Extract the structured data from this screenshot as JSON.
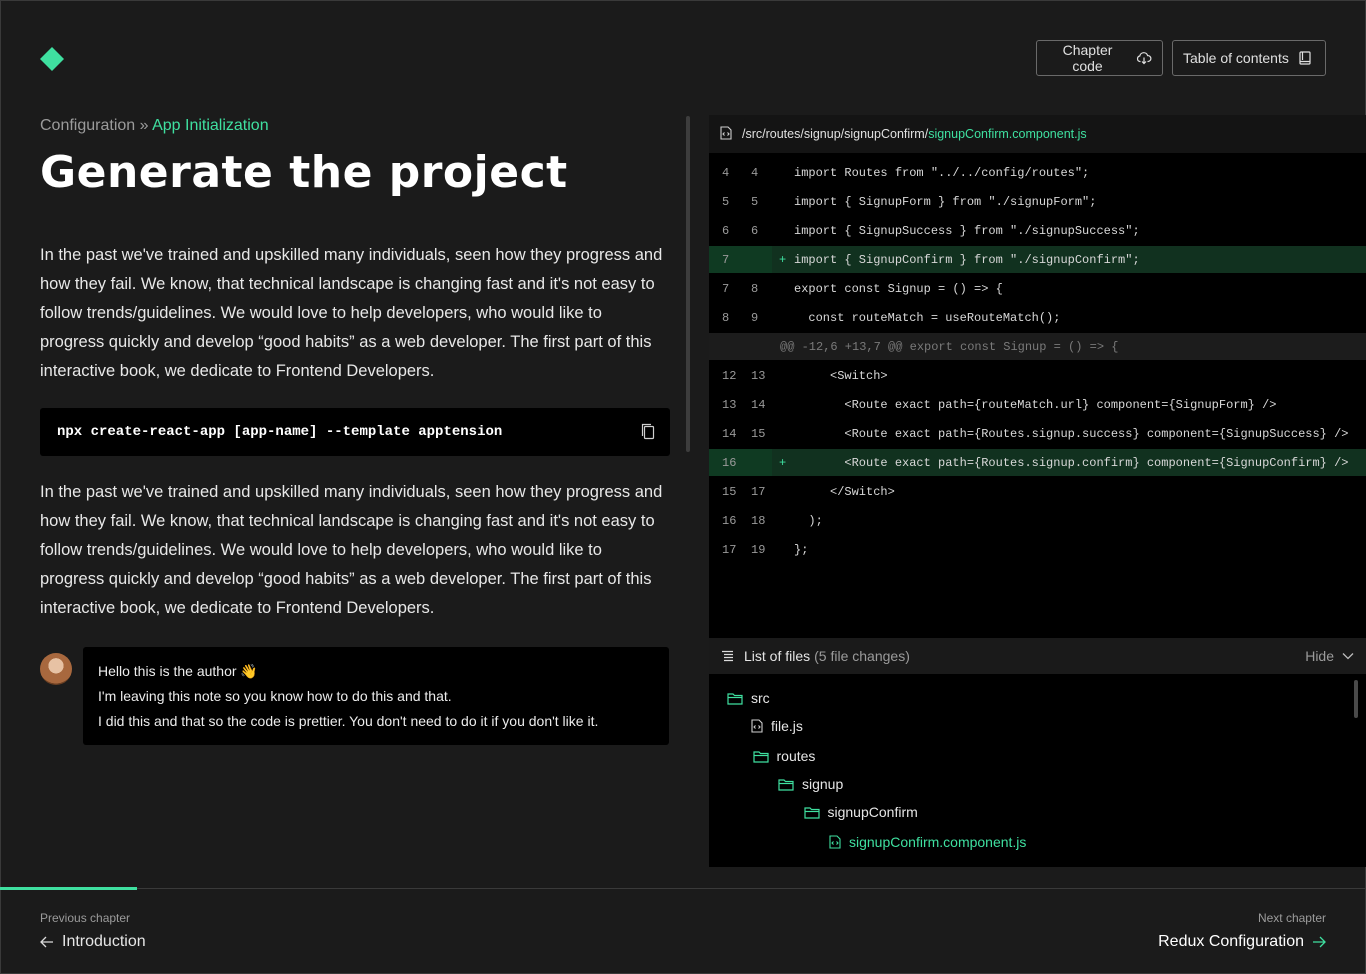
{
  "header": {
    "chapter_code_label": "Chapter code",
    "toc_label": "Table of contents"
  },
  "breadcrumb": {
    "parent": "Configuration",
    "separator": " » ",
    "current": "App Initialization"
  },
  "page_title": "Generate the project",
  "paragraph_1": "In the past we've trained and upskilled many individuals, seen how they progress and how they fail. We know, that technical landscape is changing fast and it's not easy to follow trends/guidelines. We would love to help developers, who would like to progress quickly and develop “good habits” as a web developer. The first part of this interactive book, we dedicate to Frontend Developers.",
  "command": "npx create-react-app [app-name] --template apptension",
  "paragraph_2": "In the past we've trained and upskilled many individuals, seen how they progress and how they fail. We know, that technical landscape is changing fast and it's not easy to follow trends/guidelines. We would love to help developers, who would like to progress quickly and develop “good habits” as a web developer. The first part of this interactive book, we dedicate to Frontend Developers.",
  "author_note": {
    "line1": "Hello this is the author 👋",
    "line2": "I'm leaving this note so you know how to do this and that.",
    "line3": "I did this and that so the code is prettier. You don't need to do it if you don't like it."
  },
  "code": {
    "path_prefix": "/src/routes/signup/signupConfirm/",
    "file_name": "signupConfirm.component.js",
    "lines": [
      {
        "a": "4",
        "b": "4",
        "mark": "",
        "text": "import Routes from \"../../config/routes\";",
        "kind": "normal"
      },
      {
        "a": "5",
        "b": "5",
        "mark": "",
        "text": "import { SignupForm } from \"./signupForm\";",
        "kind": "normal"
      },
      {
        "a": "6",
        "b": "6",
        "mark": "",
        "text": "import { SignupSuccess } from \"./signupSuccess\";",
        "kind": "normal"
      },
      {
        "a": "7",
        "b": "",
        "mark": "+",
        "text": "import { SignupConfirm } from \"./signupConfirm\";",
        "kind": "added"
      },
      {
        "a": "7",
        "b": "8",
        "mark": "",
        "text": "export const Signup = () => {",
        "kind": "normal"
      },
      {
        "a": "8",
        "b": "9",
        "mark": "",
        "text": "  const routeMatch = useRouteMatch();",
        "kind": "normal"
      },
      {
        "a": "",
        "b": "",
        "mark": "",
        "text": "@@ -12,6 +13,7 @@ export const Signup = () => {",
        "kind": "hunk"
      },
      {
        "a": "12",
        "b": "13",
        "mark": "",
        "text": "     <Switch>",
        "kind": "normal"
      },
      {
        "a": "13",
        "b": "14",
        "mark": "",
        "text": "       <Route exact path={routeMatch.url} component={SignupForm} />",
        "kind": "normal"
      },
      {
        "a": "14",
        "b": "15",
        "mark": "",
        "text": "       <Route exact path={Routes.signup.success} component={SignupSuccess} />",
        "kind": "normal"
      },
      {
        "a": "16",
        "b": "",
        "mark": "+",
        "text": "       <Route exact path={Routes.signup.confirm} component={SignupConfirm} />",
        "kind": "added"
      },
      {
        "a": "15",
        "b": "17",
        "mark": "",
        "text": "     </Switch>",
        "kind": "normal"
      },
      {
        "a": "16",
        "b": "18",
        "mark": "",
        "text": "  );",
        "kind": "normal"
      },
      {
        "a": "17",
        "b": "19",
        "mark": "",
        "text": "};",
        "kind": "normal"
      }
    ]
  },
  "files": {
    "title": "List of files",
    "count": "(5 file changes)",
    "hide_label": "Hide",
    "tree": [
      {
        "label": "src",
        "type": "folder",
        "depth": 0,
        "active": false
      },
      {
        "label": "file.js",
        "type": "file",
        "depth": 1,
        "active": false
      },
      {
        "label": "routes",
        "type": "folder",
        "depth": 1,
        "active": false
      },
      {
        "label": "signup",
        "type": "folder",
        "depth": 2,
        "active": false
      },
      {
        "label": "signupConfirm",
        "type": "folder",
        "depth": 3,
        "active": false
      },
      {
        "label": "signupConfirm.component.js",
        "type": "file",
        "depth": 4,
        "active": true
      }
    ]
  },
  "footer": {
    "prev_caption": "Previous chapter",
    "prev_label": "Introduction",
    "next_caption": "Next chapter",
    "next_label": "Redux Configuration",
    "progress": 0.1
  },
  "colors": {
    "accent": "#3fe0a0",
    "background": "#1b1b1b"
  }
}
